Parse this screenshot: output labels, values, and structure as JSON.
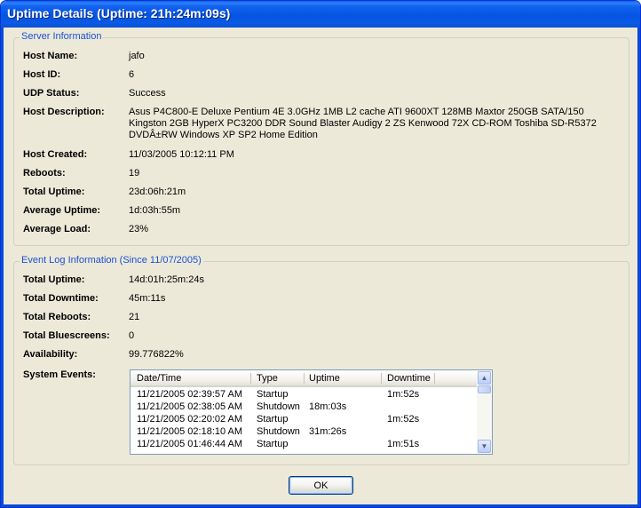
{
  "window": {
    "title": "Uptime Details (Uptime: 21h:24m:09s)"
  },
  "server": {
    "legend": "Server Information",
    "rows": [
      {
        "label": "Host Name:",
        "value": "jafo"
      },
      {
        "label": "Host ID:",
        "value": "6"
      },
      {
        "label": "UDP Status:",
        "value": "Success"
      },
      {
        "label": "Host Description:",
        "value": "Asus P4C800-E Deluxe Pentium 4E 3.0GHz 1MB L2 cache ATI 9600XT 128MB Maxtor 250GB SATA/150 Kingston 2GB HyperX PC3200 DDR Sound Blaster Audigy 2 ZS Kenwood 72X CD-ROM Toshiba SD-R5372 DVDÂ±RW Windows XP SP2 Home Edition"
      },
      {
        "label": "Host Created:",
        "value": "11/03/2005 10:12:11 PM"
      },
      {
        "label": "Reboots:",
        "value": "19"
      },
      {
        "label": "Total Uptime:",
        "value": "23d:06h:21m"
      },
      {
        "label": "Average Uptime:",
        "value": "1d:03h:55m"
      },
      {
        "label": "Average Load:",
        "value": "23%"
      }
    ]
  },
  "eventlog": {
    "legend": "Event Log Information (Since 11/07/2005)",
    "rows": [
      {
        "label": "Total Uptime:",
        "value": "14d:01h:25m:24s"
      },
      {
        "label": "Total Downtime:",
        "value": "45m:11s"
      },
      {
        "label": "Total Reboots:",
        "value": "21"
      },
      {
        "label": "Total Bluescreens:",
        "value": "0"
      },
      {
        "label": "Availability:",
        "value": "99.776822%"
      },
      {
        "label": "System Events:",
        "value": ""
      }
    ],
    "table": {
      "columns": [
        "Date/Time",
        "Type",
        "Uptime",
        "Downtime"
      ],
      "rows": [
        [
          "11/21/2005 02:39:57 AM",
          "Startup",
          "",
          "1m:52s"
        ],
        [
          "11/21/2005 02:38:05 AM",
          "Shutdown",
          "18m:03s",
          ""
        ],
        [
          "11/21/2005 02:20:02 AM",
          "Startup",
          "",
          "1m:52s"
        ],
        [
          "11/21/2005 02:18:10 AM",
          "Shutdown",
          "31m:26s",
          ""
        ],
        [
          "11/21/2005 01:46:44 AM",
          "Startup",
          "",
          "1m:51s"
        ]
      ],
      "scroll_up_icon": "up-arrow",
      "scroll_down_icon": "down-arrow"
    }
  },
  "buttons": {
    "ok_label": "OK"
  },
  "colors": {
    "titlebar": "#0555E3",
    "dialog_bg": "#ECE9D8",
    "legend_text": "#1A50D6"
  }
}
